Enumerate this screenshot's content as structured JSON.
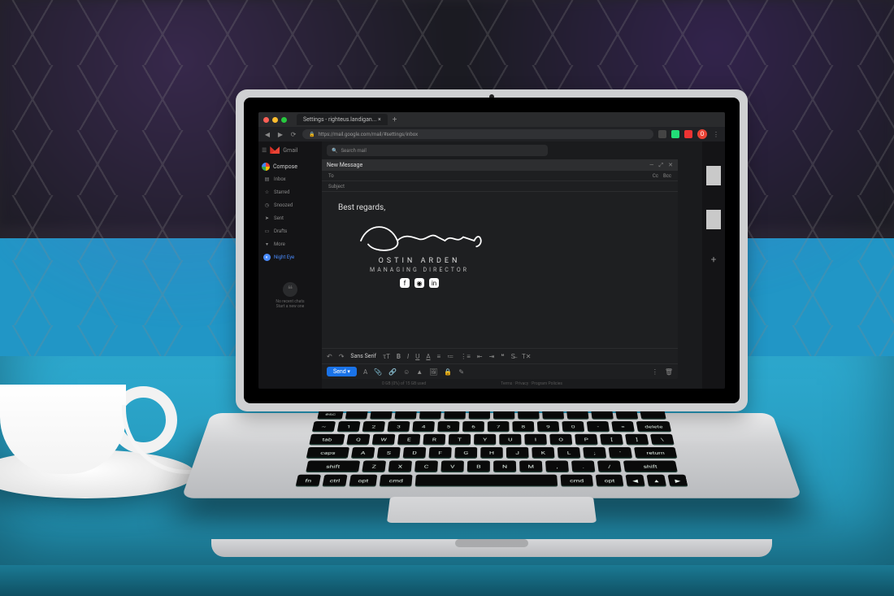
{
  "browser": {
    "tab_title": "Settings - righteus.landigan... ×",
    "url": "https://mail.google.com/mail/#settings/inbox",
    "lock_icon": "lock-icon"
  },
  "gmail": {
    "brand": "Gmail",
    "search_placeholder": "Search mail",
    "compose_label": "Compose",
    "sidebar": [
      {
        "icon": "inbox",
        "label": "Inbox"
      },
      {
        "icon": "star",
        "label": "Starred"
      },
      {
        "icon": "clock",
        "label": "Snoozed"
      },
      {
        "icon": "send",
        "label": "Sent"
      },
      {
        "icon": "file",
        "label": "Drafts"
      },
      {
        "icon": "chevron",
        "label": "More"
      }
    ],
    "night_eye": "Night Eye",
    "hangouts_empty1": "No recent chats",
    "hangouts_empty2": "Start a new one"
  },
  "compose": {
    "window_title": "New Message",
    "to_label": "To",
    "cc": "Cc",
    "bcc": "Bcc",
    "subject_label": "Subject",
    "body_greeting": "Best regards,",
    "signature": {
      "name": "OSTIN ARDEN",
      "title": "MANAGING DIRECTOR",
      "social": [
        "facebook",
        "instagram",
        "linkedin"
      ]
    },
    "send": "Send",
    "font_label": "Sans Serif",
    "toolbar_icons": [
      "format",
      "bold",
      "italic",
      "underline",
      "color",
      "align",
      "list-ol",
      "list-ul",
      "indent",
      "outdent",
      "quote",
      "strike",
      "clear"
    ],
    "action_icons": [
      "attach",
      "link",
      "emoji",
      "drive",
      "image",
      "lock",
      "pen"
    ],
    "trash": "trash"
  },
  "footer": {
    "left": "0 GB (0%) of 15 GB used",
    "center": "Terms · Privacy · Program Policies"
  },
  "colors": {
    "accent": "#1a73e8"
  }
}
